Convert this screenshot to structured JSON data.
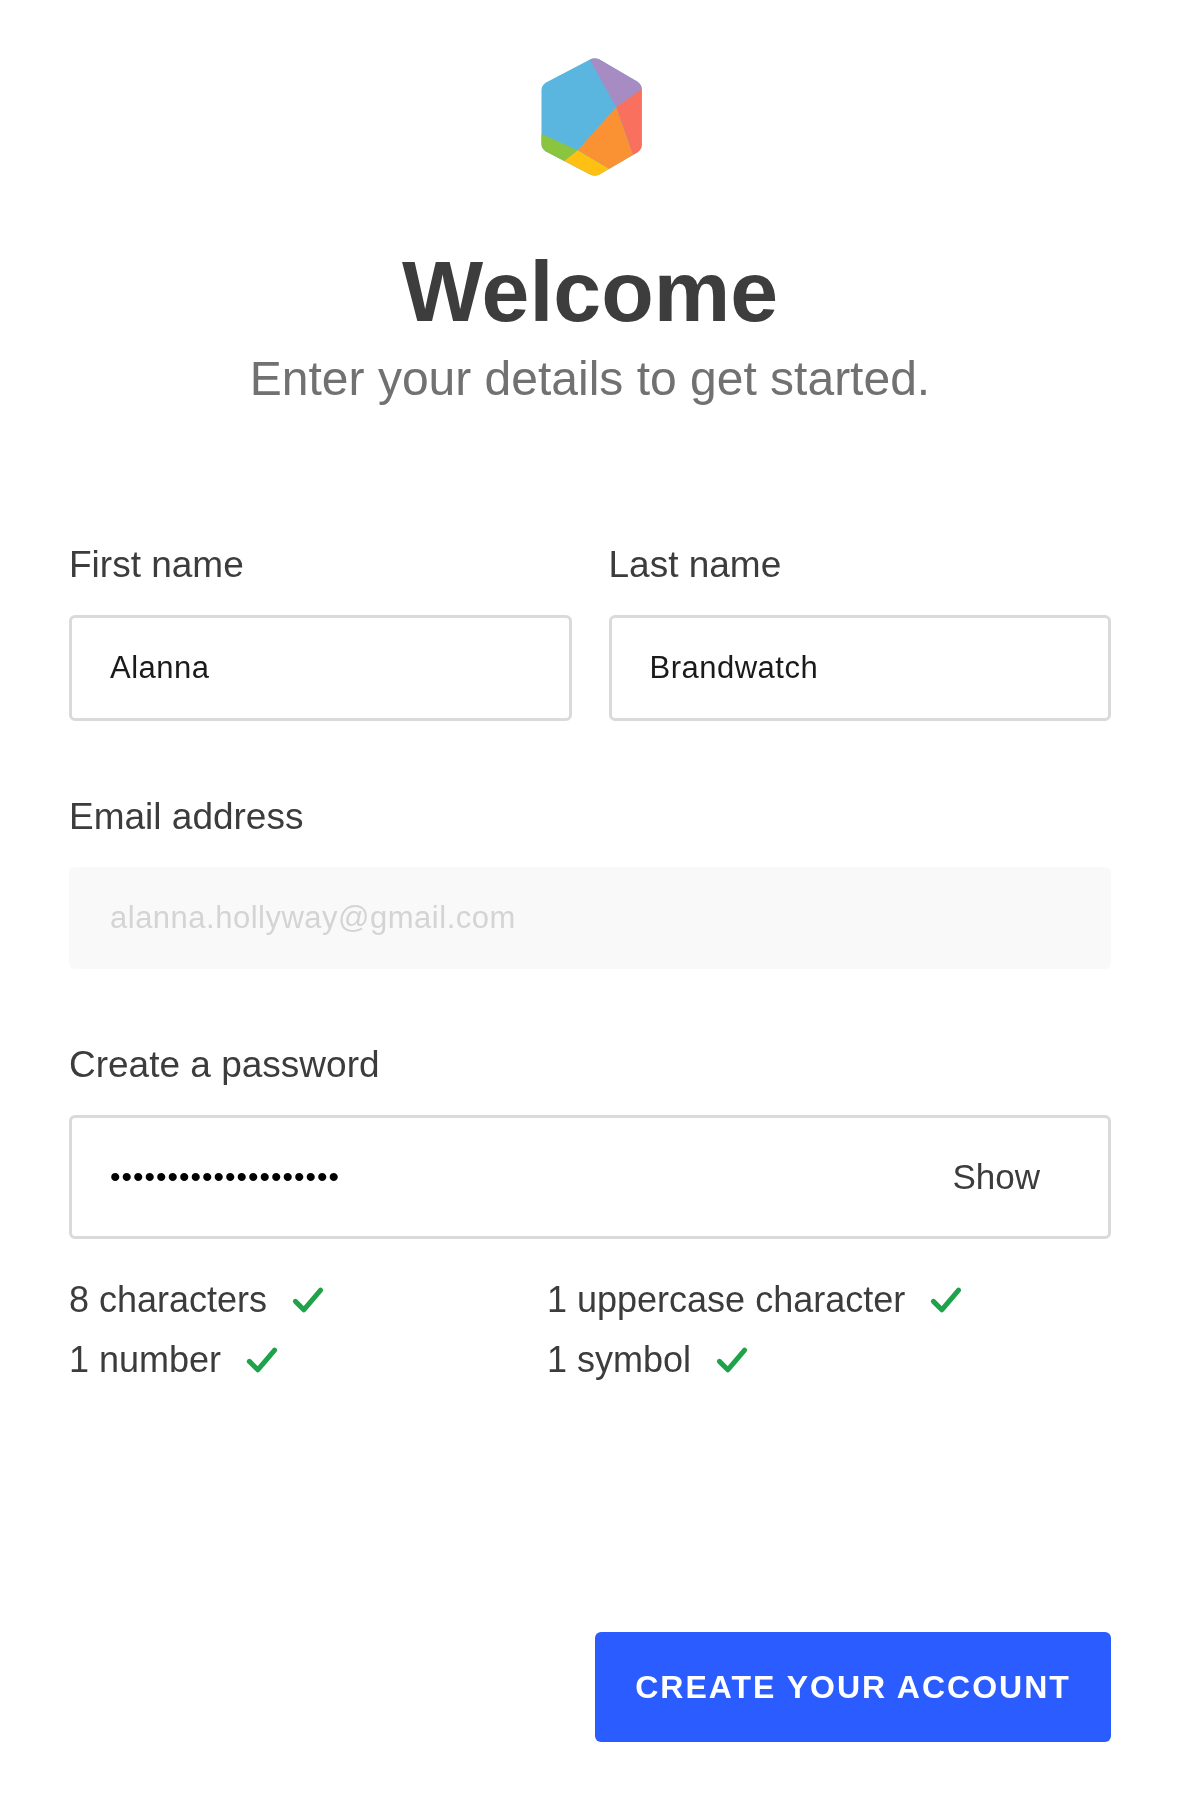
{
  "header": {
    "title": "Welcome",
    "subtitle": "Enter your details to get started."
  },
  "fields": [
    {
      "kind": "half",
      "label": "First name",
      "value": "Alanna",
      "disabled": false
    },
    {
      "kind": "half",
      "label": "Last name",
      "value": "Brandwatch",
      "disabled": false
    },
    {
      "kind": "full",
      "label": "Email address",
      "value": "alanna.hollyway@gmail.com",
      "disabled": true
    },
    {
      "kind": "password",
      "label": "Create a password",
      "value": "••••••••••••••••••••",
      "disabled": false,
      "toggle": "Show"
    }
  ],
  "requirements": [
    {
      "text": "8 characters",
      "met": true
    },
    {
      "text": "1 uppercase character",
      "met": true
    },
    {
      "text": "1 number",
      "met": true
    },
    {
      "text": "1 symbol",
      "met": true
    }
  ],
  "submit": "CREATE YOUR ACCOUNT"
}
